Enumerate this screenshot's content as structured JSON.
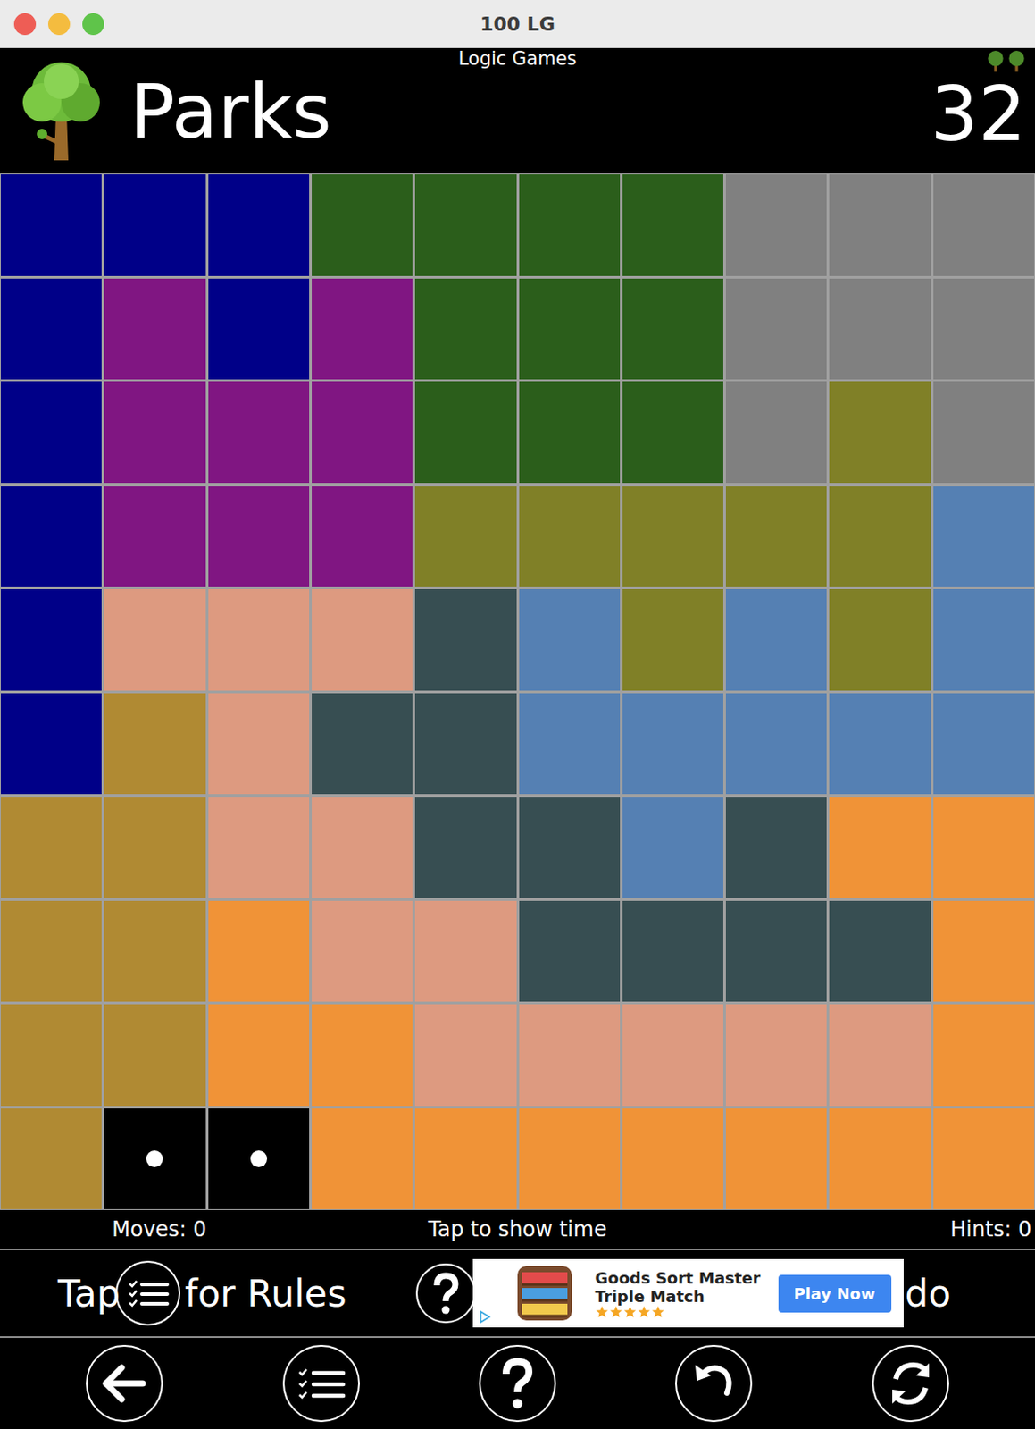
{
  "window": {
    "title": "100 LG"
  },
  "header": {
    "subtitle": "Logic Games",
    "title": "Parks",
    "level": "32"
  },
  "grid": [
    [
      {
        "color": "#000088",
        "dot": false
      },
      {
        "color": "#000088",
        "dot": false
      },
      {
        "color": "#000088",
        "dot": false
      },
      {
        "color": "#2b5e1b",
        "dot": false
      },
      {
        "color": "#2b5e1b",
        "dot": false
      },
      {
        "color": "#2b5e1b",
        "dot": false
      },
      {
        "color": "#2b5e1b",
        "dot": false
      },
      {
        "color": "#808080",
        "dot": false
      },
      {
        "color": "#808080",
        "dot": false
      },
      {
        "color": "#808080",
        "dot": false
      }
    ],
    [
      {
        "color": "#000088",
        "dot": false
      },
      {
        "color": "#801682",
        "dot": false
      },
      {
        "color": "#000088",
        "dot": false
      },
      {
        "color": "#801682",
        "dot": false
      },
      {
        "color": "#2b5e1b",
        "dot": false
      },
      {
        "color": "#2b5e1b",
        "dot": false
      },
      {
        "color": "#2b5e1b",
        "dot": false
      },
      {
        "color": "#808080",
        "dot": false
      },
      {
        "color": "#808080",
        "dot": false
      },
      {
        "color": "#808080",
        "dot": false
      }
    ],
    [
      {
        "color": "#000088",
        "dot": false
      },
      {
        "color": "#801682",
        "dot": false
      },
      {
        "color": "#801682",
        "dot": false
      },
      {
        "color": "#801682",
        "dot": false
      },
      {
        "color": "#2b5e1b",
        "dot": false
      },
      {
        "color": "#2b5e1b",
        "dot": false
      },
      {
        "color": "#2b5e1b",
        "dot": false
      },
      {
        "color": "#808080",
        "dot": false
      },
      {
        "color": "#808027",
        "dot": false
      },
      {
        "color": "#808080",
        "dot": false
      }
    ],
    [
      {
        "color": "#000088",
        "dot": false
      },
      {
        "color": "#801682",
        "dot": false
      },
      {
        "color": "#801682",
        "dot": false
      },
      {
        "color": "#801682",
        "dot": false
      },
      {
        "color": "#808027",
        "dot": false
      },
      {
        "color": "#808027",
        "dot": false
      },
      {
        "color": "#808027",
        "dot": false
      },
      {
        "color": "#808027",
        "dot": false
      },
      {
        "color": "#808027",
        "dot": false
      },
      {
        "color": "#5580b3",
        "dot": false
      }
    ],
    [
      {
        "color": "#000088",
        "dot": false
      },
      {
        "color": "#dd9a80",
        "dot": false
      },
      {
        "color": "#dd9a80",
        "dot": false
      },
      {
        "color": "#dd9a80",
        "dot": false
      },
      {
        "color": "#374e52",
        "dot": false
      },
      {
        "color": "#5580b3",
        "dot": false
      },
      {
        "color": "#808027",
        "dot": false
      },
      {
        "color": "#5580b3",
        "dot": false
      },
      {
        "color": "#808027",
        "dot": false
      },
      {
        "color": "#5580b3",
        "dot": false
      }
    ],
    [
      {
        "color": "#000088",
        "dot": false
      },
      {
        "color": "#b08a33",
        "dot": false
      },
      {
        "color": "#dd9a80",
        "dot": false
      },
      {
        "color": "#374e52",
        "dot": false
      },
      {
        "color": "#374e52",
        "dot": false
      },
      {
        "color": "#5580b3",
        "dot": false
      },
      {
        "color": "#5580b3",
        "dot": false
      },
      {
        "color": "#5580b3",
        "dot": false
      },
      {
        "color": "#5580b3",
        "dot": false
      },
      {
        "color": "#5580b3",
        "dot": false
      }
    ],
    [
      {
        "color": "#b08a33",
        "dot": false
      },
      {
        "color": "#b08a33",
        "dot": false
      },
      {
        "color": "#dd9a80",
        "dot": false
      },
      {
        "color": "#dd9a80",
        "dot": false
      },
      {
        "color": "#374e52",
        "dot": false
      },
      {
        "color": "#374e52",
        "dot": false
      },
      {
        "color": "#5580b3",
        "dot": false
      },
      {
        "color": "#374e52",
        "dot": false
      },
      {
        "color": "#f09337",
        "dot": false
      },
      {
        "color": "#f09337",
        "dot": false
      }
    ],
    [
      {
        "color": "#b08a33",
        "dot": false
      },
      {
        "color": "#b08a33",
        "dot": false
      },
      {
        "color": "#f09337",
        "dot": false
      },
      {
        "color": "#dd9a80",
        "dot": false
      },
      {
        "color": "#dd9a80",
        "dot": false
      },
      {
        "color": "#374e52",
        "dot": false
      },
      {
        "color": "#374e52",
        "dot": false
      },
      {
        "color": "#374e52",
        "dot": false
      },
      {
        "color": "#374e52",
        "dot": false
      },
      {
        "color": "#f09337",
        "dot": false
      }
    ],
    [
      {
        "color": "#b08a33",
        "dot": false
      },
      {
        "color": "#b08a33",
        "dot": false
      },
      {
        "color": "#f09337",
        "dot": false
      },
      {
        "color": "#f09337",
        "dot": false
      },
      {
        "color": "#dd9a80",
        "dot": false
      },
      {
        "color": "#dd9a80",
        "dot": false
      },
      {
        "color": "#dd9a80",
        "dot": false
      },
      {
        "color": "#dd9a80",
        "dot": false
      },
      {
        "color": "#dd9a80",
        "dot": false
      },
      {
        "color": "#f09337",
        "dot": false
      }
    ],
    [
      {
        "color": "#b08a33",
        "dot": false
      },
      {
        "color": "#000000",
        "dot": true
      },
      {
        "color": "#000000",
        "dot": true
      },
      {
        "color": "#f09337",
        "dot": false
      },
      {
        "color": "#f09337",
        "dot": false
      },
      {
        "color": "#f09337",
        "dot": false
      },
      {
        "color": "#f09337",
        "dot": false
      },
      {
        "color": "#f09337",
        "dot": false
      },
      {
        "color": "#f09337",
        "dot": false
      },
      {
        "color": "#f09337",
        "dot": false
      }
    ]
  ],
  "status_bar": {
    "moves": "Moves: 0",
    "timer": "Tap to show time",
    "hints": "Hints: 0"
  },
  "rules_bar": {
    "before": "Tap",
    "after": "for Rules",
    "trailing": "do"
  },
  "ad": {
    "title": "Goods Sort Master",
    "subtitle": "Triple Match",
    "stars": 5,
    "button": "Play Now"
  },
  "toolbar": [
    "back",
    "rules",
    "help",
    "undo",
    "restart"
  ]
}
